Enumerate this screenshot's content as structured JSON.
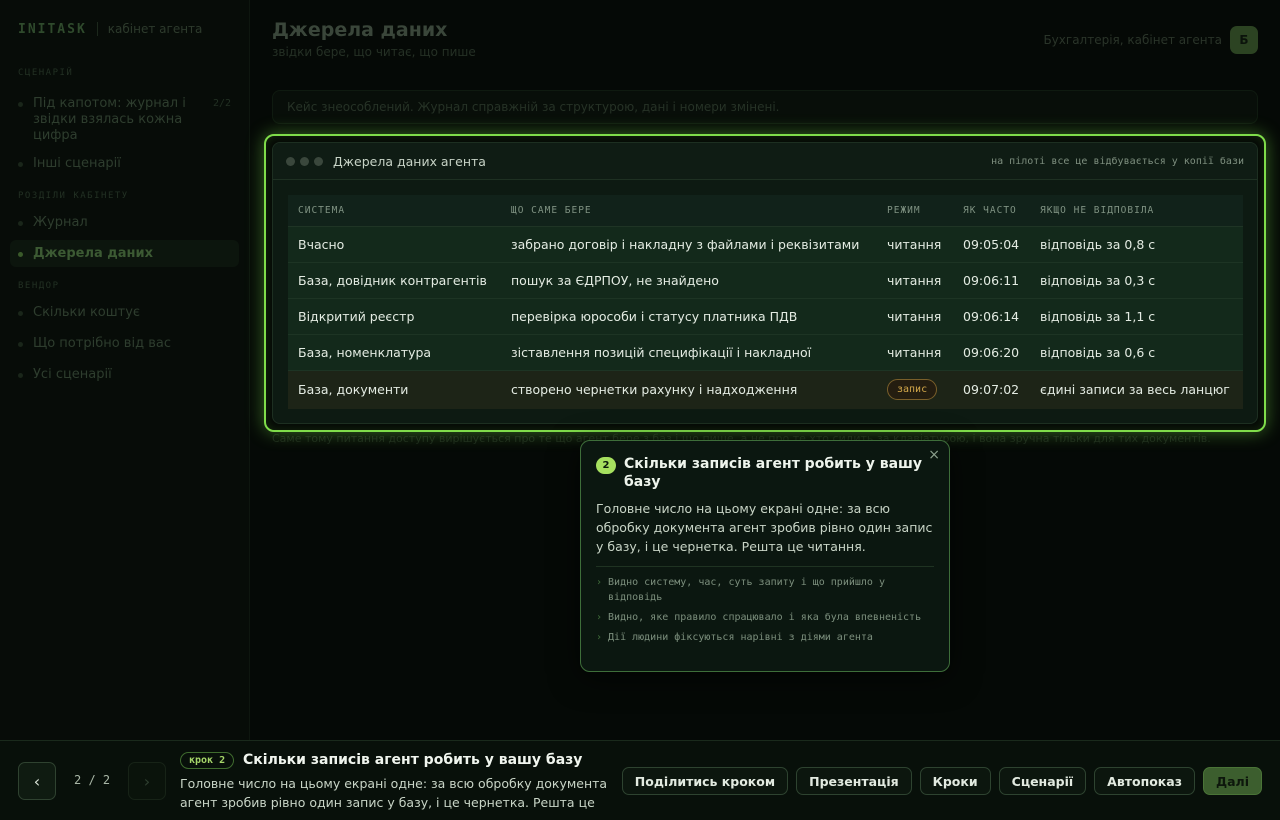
{
  "sidebar": {
    "brand": "INITASK",
    "brand_sub": "кабінет агента",
    "sections": [
      {
        "title": "СЦЕНАРІЙ",
        "items": [
          {
            "label": "Під капотом: журнал і звідки взялась кожна цифра",
            "count": "2/2"
          },
          {
            "label": "Інші сценарії"
          }
        ]
      },
      {
        "title": "РОЗДІЛИ КАБІНЕТУ",
        "items": [
          {
            "label": "Журнал"
          },
          {
            "label": "Джерела даних",
            "active": true
          }
        ]
      },
      {
        "title": "ВЕНДОР",
        "items": [
          {
            "label": "Скільки коштує"
          },
          {
            "label": "Що потрібно від вас"
          },
          {
            "label": "Усі сценарії"
          }
        ]
      }
    ]
  },
  "header": {
    "title": "Джерела даних",
    "subtitle": "звідки бере, що читає, що пише",
    "who": "Бухгалтерія, кабінет агента",
    "avatar": "Б"
  },
  "notice": "Кейс знеособлений. Журнал справжній за структурою, дані і номери змінені.",
  "bottom_note": "Саме тому питання доступу вирішується про те що агент бере з баз і що пише, а не про те хто сидить за клавіатурою, і вона зручна тільки для тих документів.",
  "panel": {
    "title": "Джерела даних агента",
    "hint": "на пілоті все це відбувається у копії бази",
    "columns": [
      "СИСТЕМА",
      "ЩО САМЕ БЕРЕ",
      "РЕЖИМ",
      "ЯК ЧАСТО",
      "ЯКЩО НЕ ВІДПОВІЛА"
    ],
    "rows": [
      [
        "Вчасно",
        "забрано договір і накладну з файлами і реквізитами",
        "читання",
        "09:05:04",
        "відповідь за 0,8 с"
      ],
      [
        "База, довідник контрагентів",
        "пошук за ЄДРПОУ, не знайдено",
        "читання",
        "09:06:11",
        "відповідь за 0,3 с"
      ],
      [
        "Відкритий реєстр",
        "перевірка юрособи і статусу платника ПДВ",
        "читання",
        "09:06:14",
        "відповідь за 1,1 с"
      ],
      [
        "База, номенклатура",
        "зіставлення позицій специфікації і накладної",
        "читання",
        "09:06:20",
        "відповідь за 0,6 с"
      ],
      [
        "База, документи",
        "створено чернетки рахунку і надходження",
        "запис",
        "09:07:02",
        "єдині записи за весь ланцюг"
      ]
    ]
  },
  "popover": {
    "step": "2",
    "title": "Скільки записів агент робить у вашу базу",
    "body": "Головне число на цьому екрані одне: за всю обробку документа агент зробив рівно один запис у базу, і це чернетка. Решта це читання.",
    "bullets": [
      "Видно систему, час, суть запиту і що прийшло у відповідь",
      "Видно, яке правило спрацювало і яка була впевненість",
      "Дії людини фіксуються нарівні з діями агента"
    ],
    "close": "×"
  },
  "bottombar": {
    "prev": "‹",
    "next": "›",
    "pager": "2 / 2",
    "step_tag": "крок 2",
    "step_title": "Скільки записів агент робить у вашу базу",
    "step_desc": "Головне число на цьому екрані одне: за всю обробку документа агент зробив рівно один запис у базу, і це чернетка. Решта це читання.",
    "actions": [
      "Поділитись кроком",
      "Презентація",
      "Кроки",
      "Сценарії",
      "Автопоказ"
    ],
    "primary": "Далі"
  }
}
